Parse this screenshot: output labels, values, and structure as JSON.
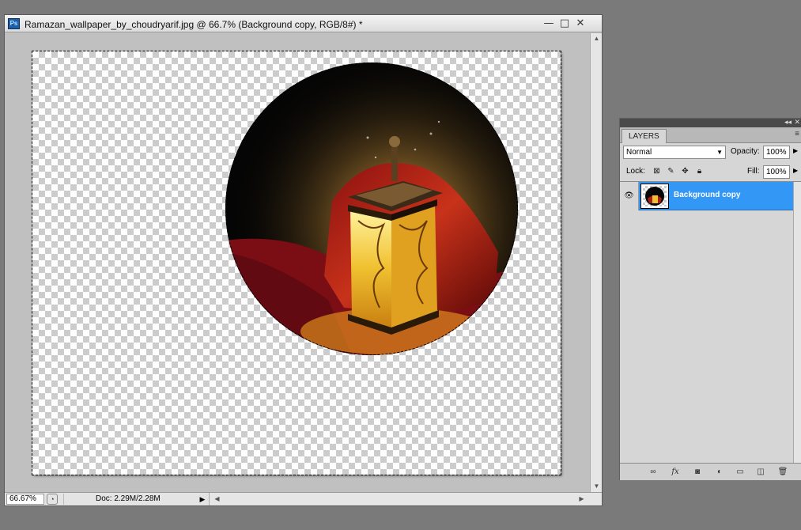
{
  "document": {
    "title": "Ramazan_wallpaper_by_choudryarif.jpg @ 66.7% (Background copy, RGB/8#) *",
    "app_icon": "Ps",
    "window_buttons": [
      "—",
      "□",
      "✕"
    ]
  },
  "status": {
    "zoom": "66.67%",
    "doc_info": "Doc: 2.29M/2.28M"
  },
  "layers_panel": {
    "tab": "LAYERS",
    "blend_mode": "Normal",
    "opacity_label": "Opacity:",
    "opacity": "100%",
    "lock_label": "Lock:",
    "fill_label": "Fill:",
    "fill": "100%",
    "layers": [
      {
        "name": "Background copy",
        "visible": true,
        "selected": true
      }
    ]
  },
  "colors": {
    "selection_highlight": "#3398f5",
    "canvas_bg": "#c0c0c0",
    "workspace": "#7a7a7a"
  },
  "icons": [
    "photoshop-app-icon",
    "minimize-icon",
    "maximize-icon",
    "close-icon",
    "eye-icon",
    "link-icon",
    "fx-icon",
    "mask-icon",
    "adjustment-icon",
    "folder-icon",
    "new-layer-icon",
    "trash-icon"
  ]
}
